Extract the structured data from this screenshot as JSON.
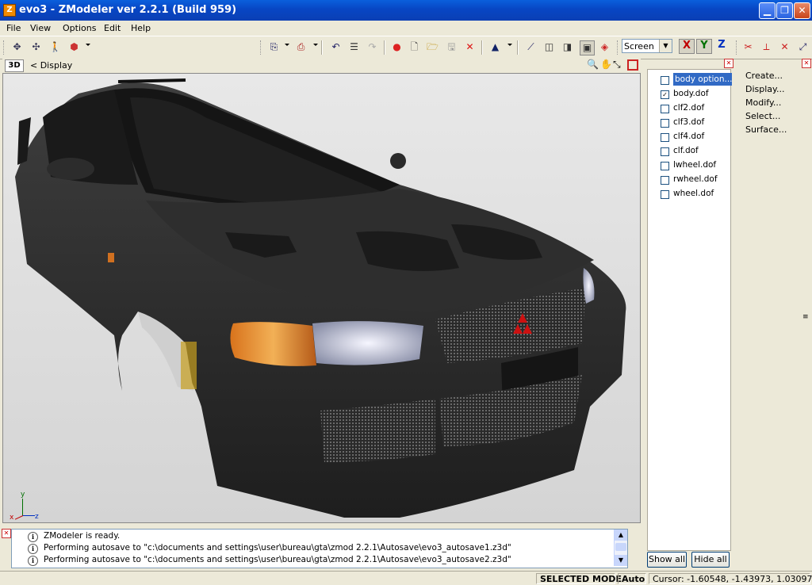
{
  "window": {
    "title": "evo3 - ZModeler ver 2.2.1 (Build 959)",
    "app_icon_letter": "Z",
    "minimize_icon": "minimize-icon",
    "maximize_icon": "restore-icon",
    "close_icon": "close-icon"
  },
  "menu": [
    "File",
    "View",
    "Options",
    "Edit",
    "Help"
  ],
  "toolbar": {
    "view_mode": "Screen",
    "axes": [
      "X",
      "Y",
      "Z"
    ],
    "colors": {
      "x": "#c00000",
      "y": "#007000",
      "z": "#0030c0"
    }
  },
  "viewport": {
    "mode_label": "3D",
    "breadcrumb": "< Display",
    "axis_labels": {
      "x": "x",
      "y": "y",
      "z": "z"
    }
  },
  "objects": [
    {
      "name": "body option...",
      "checked": false,
      "selected": true
    },
    {
      "name": "body.dof",
      "checked": true,
      "selected": false
    },
    {
      "name": "clf2.dof",
      "checked": false,
      "selected": false
    },
    {
      "name": "clf3.dof",
      "checked": false,
      "selected": false
    },
    {
      "name": "clf4.dof",
      "checked": false,
      "selected": false
    },
    {
      "name": "clf.dof",
      "checked": false,
      "selected": false
    },
    {
      "name": "lwheel.dof",
      "checked": false,
      "selected": false
    },
    {
      "name": "rwheel.dof",
      "checked": false,
      "selected": false
    },
    {
      "name": "wheel.dof",
      "checked": false,
      "selected": false
    }
  ],
  "object_buttons": {
    "show_all": "Show all",
    "hide_all": "Hide all"
  },
  "commands": [
    "Create...",
    "Display...",
    "Modify...",
    "Select...",
    "Surface..."
  ],
  "log": [
    "ZModeler is ready.",
    "Performing autosave to \"c:\\documents and settings\\user\\bureau\\gta\\zmod 2.2.1\\Autosave\\evo3_autosave1.z3d\"",
    "Performing autosave to \"c:\\documents and settings\\user\\bureau\\gta\\zmod 2.2.1\\Autosave\\evo3_autosave2.z3d\""
  ],
  "status": {
    "mode": "SELECTED MODE",
    "snap": "Auto",
    "cursor": "Cursor: -1.60548, -1.43973, 1.03097"
  }
}
